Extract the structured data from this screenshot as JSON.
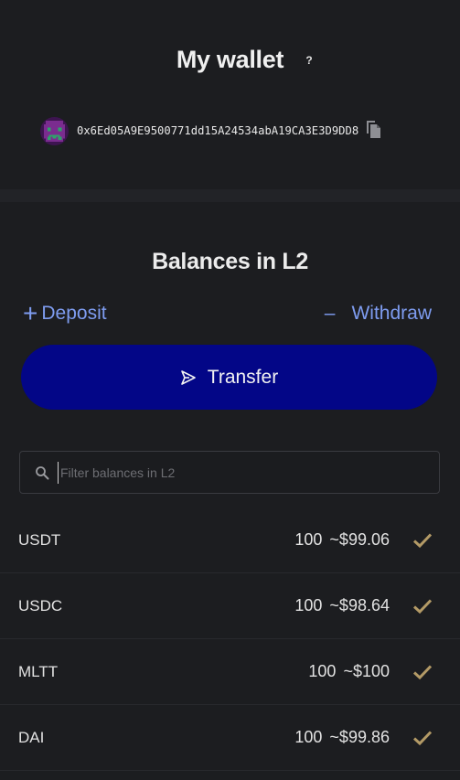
{
  "wallet": {
    "title": "My wallet",
    "help_label": "?",
    "address": "0x6Ed05A9E9500771dd15A24534abA19CA3E3D9DD8",
    "avatar_icon": "pixel-avatar-icon",
    "copy_icon": "copy-icon"
  },
  "balances": {
    "title": "Balances in L2",
    "deposit_icon": "+",
    "deposit_label": "Deposit",
    "withdraw_icon": "–",
    "withdraw_label": "Withdraw",
    "transfer_label": "Transfer",
    "filter_placeholder": "Filter balances in L2",
    "filter_value": "",
    "tokens": [
      {
        "symbol": "USDT",
        "amount": "100",
        "usd": "~$99.06"
      },
      {
        "symbol": "USDC",
        "amount": "100",
        "usd": "~$98.64"
      },
      {
        "symbol": "MLTT",
        "amount": "100",
        "usd": "~$100"
      },
      {
        "symbol": "DAI",
        "amount": "100",
        "usd": "~$99.86"
      }
    ]
  },
  "colors": {
    "background": "#1c1d20",
    "accent_link": "#7e9cf0",
    "transfer_button": "#030687",
    "check": "#b39a66",
    "avatar_purple": "#7a2c8f",
    "avatar_green": "#2ea36a"
  }
}
